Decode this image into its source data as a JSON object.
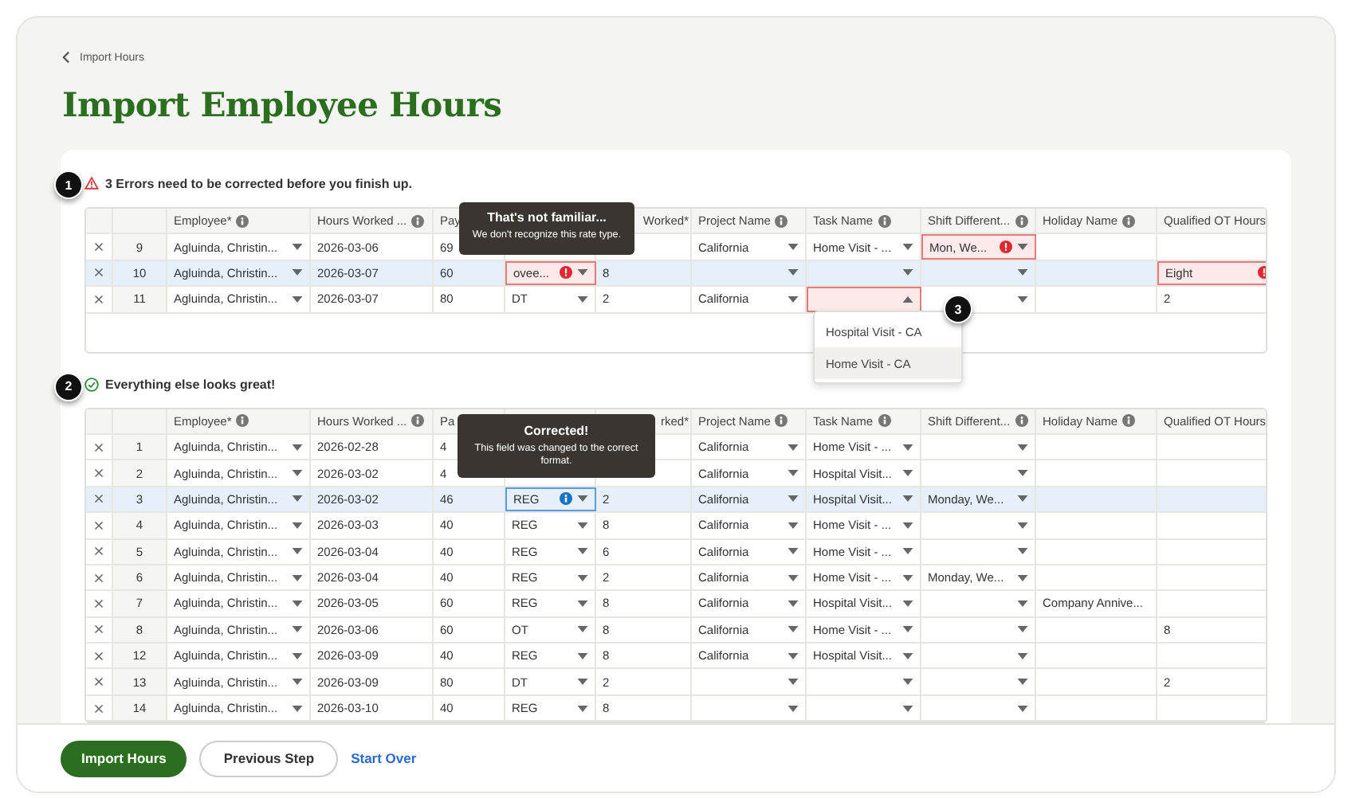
{
  "breadcrumb": "Import Hours",
  "title": "Import Employee Hours",
  "sections": [
    {
      "kind": "errors",
      "step": "1",
      "message": "3 Errors need to be corrected before you finish up.",
      "columns": [
        {
          "label": "Employee*",
          "info": true,
          "kind": "select"
        },
        {
          "label": "Hours Worked ...",
          "info": true,
          "kind": "text"
        },
        {
          "label": "Pay",
          "info": false,
          "kind": "text"
        },
        {
          "kind": "select"
        },
        {
          "label": "Worked*",
          "info": false,
          "kind": "text"
        },
        {
          "label": "Project Name",
          "info": true,
          "kind": "select"
        },
        {
          "label": "Task Name",
          "info": true,
          "kind": "select"
        },
        {
          "label": "Shift Different...",
          "info": true,
          "kind": "select"
        },
        {
          "label": "Holiday Name",
          "info": true,
          "kind": "text"
        },
        {
          "label": "Qualified OT Hours",
          "info": false,
          "kind": "text"
        }
      ],
      "tooltip": {
        "kind": "error",
        "title": "That's not familiar...",
        "text": "We don't recognize this rate type."
      },
      "rows": [
        {
          "n": "9",
          "selected": false,
          "cells": [
            "Agluinda, Christin...",
            "2026-03-06",
            "69",
            null,
            null,
            "California",
            "Home Visit - ...",
            {
              "text": "Mon, We...",
              "error": true
            },
            null,
            null
          ]
        },
        {
          "n": "10",
          "selected": true,
          "cells": [
            "Agluinda, Christin...",
            "2026-03-07",
            "60",
            {
              "text": "ovee...",
              "error": true
            },
            "8",
            null,
            null,
            null,
            null,
            {
              "text": "Eight",
              "error": true
            }
          ]
        },
        {
          "n": "11",
          "selected": false,
          "cells": [
            "Agluinda, Christin...",
            "2026-03-07",
            "80",
            "DT",
            "2",
            "California",
            {
              "error": true,
              "open": true
            },
            null,
            null,
            "2"
          ]
        }
      ],
      "dropdown": {
        "step": "3",
        "options": [
          {
            "label": "Hospital Visit - CA",
            "selected": false
          },
          {
            "label": "Home Visit - CA",
            "selected": true
          }
        ]
      }
    },
    {
      "kind": "ok",
      "step": "2",
      "message": "Everything else looks great!",
      "columns": [
        {
          "label": "Employee*",
          "info": true,
          "kind": "select"
        },
        {
          "label": "Hours Worked ...",
          "info": true,
          "kind": "text"
        },
        {
          "label": "Pa",
          "info": false,
          "kind": "text"
        },
        {
          "kind": "select"
        },
        {
          "label": "rked*",
          "info": false,
          "kind": "text"
        },
        {
          "label": "Project Name",
          "info": true,
          "kind": "select"
        },
        {
          "label": "Task Name",
          "info": true,
          "kind": "select"
        },
        {
          "label": "Shift Different...",
          "info": true,
          "kind": "select"
        },
        {
          "label": "Holiday Name",
          "info": true,
          "kind": "text"
        },
        {
          "label": "Qualified OT Hours",
          "info": false,
          "kind": "text"
        }
      ],
      "tooltip": {
        "kind": "corrected",
        "title": "Corrected!",
        "text": "This field was changed to the correct format."
      },
      "rows": [
        {
          "n": "1",
          "selected": false,
          "cells": [
            "Agluinda, Christin...",
            "2026-02-28",
            "4",
            null,
            null,
            "California",
            "Home Visit - ...",
            null,
            null,
            null
          ]
        },
        {
          "n": "2",
          "selected": false,
          "cells": [
            "Agluinda, Christin...",
            "2026-03-02",
            "4",
            null,
            null,
            "California",
            "Hospital Visit...",
            null,
            null,
            null
          ]
        },
        {
          "n": "3",
          "selected": true,
          "cells": [
            "Agluinda, Christin...",
            "2026-03-02",
            "46",
            {
              "text": "REG",
              "corrected": true
            },
            "2",
            "California",
            "Hospital Visit...",
            "Monday, We...",
            null,
            null
          ]
        },
        {
          "n": "4",
          "selected": false,
          "cells": [
            "Agluinda, Christin...",
            "2026-03-03",
            "40",
            "REG",
            "8",
            "California",
            "Home Visit - ...",
            null,
            null,
            null
          ]
        },
        {
          "n": "5",
          "selected": false,
          "cells": [
            "Agluinda, Christin...",
            "2026-03-04",
            "40",
            "REG",
            "6",
            "California",
            "Home Visit - ...",
            null,
            null,
            null
          ]
        },
        {
          "n": "6",
          "selected": false,
          "cells": [
            "Agluinda, Christin...",
            "2026-03-04",
            "40",
            "REG",
            "2",
            "California",
            "Home Visit - ...",
            "Monday, We...",
            null,
            null
          ]
        },
        {
          "n": "7",
          "selected": false,
          "cells": [
            "Agluinda, Christin...",
            "2026-03-05",
            "60",
            "REG",
            "8",
            "California",
            "Hospital Visit...",
            null,
            "Company Annive...",
            null
          ]
        },
        {
          "n": "8",
          "selected": false,
          "cells": [
            "Agluinda, Christin...",
            "2026-03-06",
            "60",
            "OT",
            "8",
            "California",
            "Home Visit - ...",
            null,
            null,
            "8"
          ]
        },
        {
          "n": "12",
          "selected": false,
          "cells": [
            "Agluinda, Christin...",
            "2026-03-09",
            "40",
            "REG",
            "8",
            "California",
            "Hospital Visit...",
            null,
            null,
            null
          ]
        },
        {
          "n": "13",
          "selected": false,
          "cells": [
            "Agluinda, Christin...",
            "2026-03-09",
            "80",
            "DT",
            "2",
            null,
            null,
            null,
            null,
            "2"
          ]
        },
        {
          "n": "14",
          "selected": false,
          "cells": [
            "Agluinda, Christin...",
            "2026-03-10",
            "40",
            "REG",
            "8",
            null,
            null,
            null,
            null,
            null
          ]
        }
      ]
    }
  ],
  "buttons": [
    {
      "label": "Import Hours",
      "kind": "primary"
    },
    {
      "label": "Previous Step",
      "kind": "secondary"
    },
    {
      "label": "Start Over",
      "kind": "link"
    }
  ]
}
